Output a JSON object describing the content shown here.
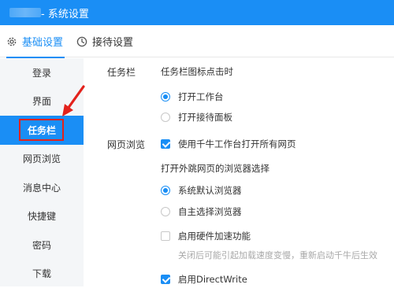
{
  "window": {
    "title": "- 系统设置"
  },
  "tabs": [
    {
      "label": "基础设置",
      "icon": "gear-icon",
      "active": true
    },
    {
      "label": "接待设置",
      "icon": "clock-icon",
      "active": false
    }
  ],
  "sidebar": {
    "items": [
      {
        "label": "登录"
      },
      {
        "label": "界面"
      },
      {
        "label": "任务栏",
        "active": true
      },
      {
        "label": "网页浏览"
      },
      {
        "label": "消息中心"
      },
      {
        "label": "快捷键"
      },
      {
        "label": "密码"
      },
      {
        "label": "下载"
      }
    ]
  },
  "content": {
    "taskbar": {
      "section_label": "任务栏",
      "option_title": "任务栏图标点击时",
      "radios": [
        {
          "label": "打开工作台",
          "checked": true
        },
        {
          "label": "打开接待面板",
          "checked": false
        }
      ]
    },
    "web": {
      "section_label": "网页浏览",
      "check_all_pages": {
        "label": "使用千牛工作台打开所有网页",
        "checked": true
      },
      "browser_title": "打开外跳网页的浏览器选择",
      "browser_radios": [
        {
          "label": "系统默认浏览器",
          "checked": true
        },
        {
          "label": "自主选择浏览器",
          "checked": false
        }
      ],
      "hardware_accel": {
        "label": "启用硬件加速功能",
        "checked": false
      },
      "hardware_hint": "关闭后可能引起加载速度变慢，重新启动千牛后生效",
      "directwrite": {
        "label": "启用DirectWrite",
        "checked": true
      }
    }
  },
  "colors": {
    "accent": "#1a8ef5",
    "highlight_box": "#e3221c",
    "sidebar_bg": "#f4f6f8"
  }
}
